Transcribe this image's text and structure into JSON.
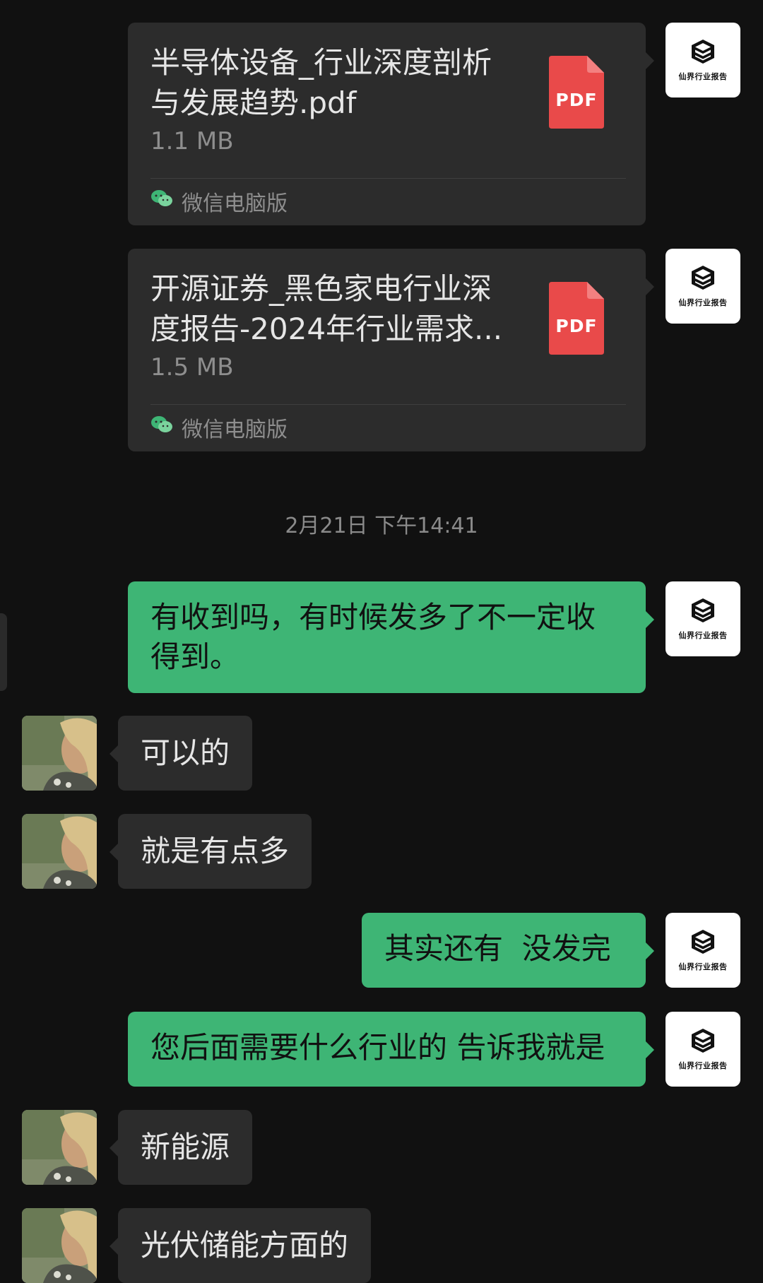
{
  "files": [
    {
      "name": "半导体设备_行业深度剖析与发展趋势.pdf",
      "size": "1.1 MB",
      "icon_label": "PDF",
      "source": "微信电脑版"
    },
    {
      "name": "开源证券_黑色家电行业深度报告-2024年行业需求...",
      "size": "1.5 MB",
      "icon_label": "PDF",
      "source": "微信电脑版"
    }
  ],
  "own_avatar_text": "仙界行业报告",
  "timestamp": "2月21日 下午14:41",
  "messages": [
    {
      "from": "me",
      "text": "有收到吗，有时候发多了不一定收得到。"
    },
    {
      "from": "peer",
      "text": "可以的"
    },
    {
      "from": "peer",
      "text": "就是有点多"
    },
    {
      "from": "me",
      "text": "其实还有  没发完"
    },
    {
      "from": "me",
      "text": "您后面需要什么行业的 告诉我就是"
    },
    {
      "from": "peer",
      "text": "新能源"
    },
    {
      "from": "peer",
      "text": "光伏储能方面的"
    }
  ],
  "colors": {
    "background": "#111111",
    "bubble_green": "#3eb575",
    "bubble_gray": "#2c2c2c",
    "pdf_red": "#e94a4a"
  }
}
